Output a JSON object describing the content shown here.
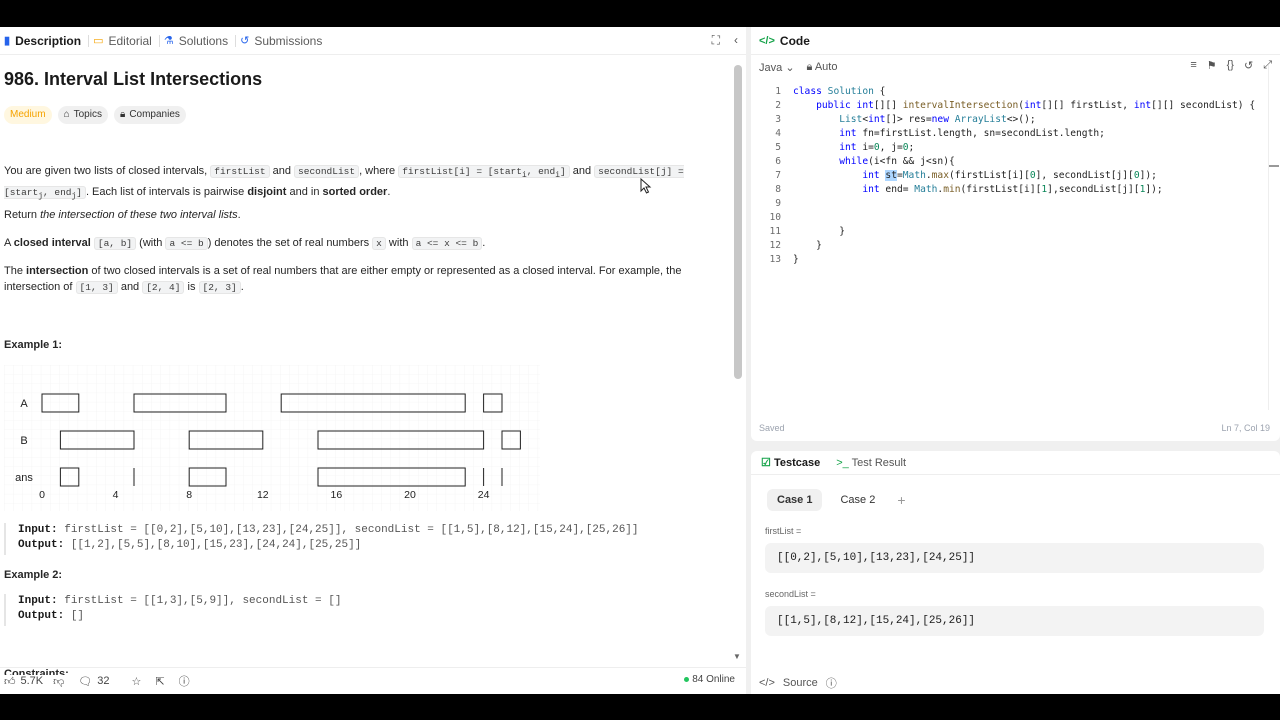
{
  "left_tabs": [
    {
      "label": "Description",
      "icon": "description-icon"
    },
    {
      "label": "Editorial",
      "icon": "editorial-icon"
    },
    {
      "label": "Solutions",
      "icon": "solutions-icon"
    },
    {
      "label": "Submissions",
      "icon": "history-icon"
    }
  ],
  "problem": {
    "title": "986. Interval List Intersections",
    "difficulty": "Medium",
    "topics_label": "Topics",
    "companies_label": "Companies",
    "p1_a": "You are given two lists of closed intervals, ",
    "p1_code1": "firstList",
    "p1_b": " and ",
    "p1_code2": "secondList",
    "p1_c": ", where ",
    "p1_code3": "firstList[i] = [start",
    "p1_sub3a": "i",
    "p1_code3b": ", end",
    "p1_sub3b": "i",
    "p1_code3c": "]",
    "p1_d": " and ",
    "p1_code4": "secondList[j] = [start",
    "p1_sub4a": "j",
    "p1_code4b": ", end",
    "p1_sub4b": "j",
    "p1_code4c": "]",
    "p1_e": ". Each list of intervals is pairwise ",
    "p1_bold1": "disjoint",
    "p1_f": " and in ",
    "p1_bold2": "sorted order",
    "p1_g": ".",
    "p2_a": "Return ",
    "p2_em": "the intersection of these two interval lists",
    "p2_b": ".",
    "p3_a": "A ",
    "p3_bold": "closed interval",
    "p3_code1": "[a, b]",
    "p3_b": " (with ",
    "p3_code2": "a <= b",
    "p3_c": ") denotes the set of real numbers ",
    "p3_code3": "x",
    "p3_d": " with ",
    "p3_code4": "a <= x <= b",
    "p3_e": ".",
    "p4_a": "The ",
    "p4_bold": "intersection",
    "p4_b": " of two closed intervals is a set of real numbers that are either empty or represented as a closed interval. For example, the intersection of ",
    "p4_code1": "[1, 3]",
    "p4_c": " and ",
    "p4_code2": "[2, 4]",
    "p4_d": " is ",
    "p4_code3": "[2, 3]",
    "p4_e": ".",
    "example1_title": "Example 1:",
    "example1_input_label": "Input:",
    "example1_input": "firstList = [[0,2],[5,10],[13,23],[24,25]], secondList = [[1,5],[8,12],[15,24],[25,26]]",
    "example1_output_label": "Output:",
    "example1_output": "[[1,2],[5,5],[8,10],[15,23],[24,24],[25,25]]",
    "example2_title": "Example 2:",
    "example2_input_label": "Input:",
    "example2_input": "firstList = [[1,3],[5,9]], secondList = []",
    "example2_output_label": "Output:",
    "example2_output": "[]",
    "constraints_title": "Constraints:"
  },
  "figure": {
    "row_labels": [
      "A",
      "B",
      "ans"
    ],
    "x_ticks": [
      "0",
      "4",
      "8",
      "12",
      "16",
      "20",
      "24"
    ],
    "A": [
      [
        0,
        2
      ],
      [
        5,
        10
      ],
      [
        13,
        23
      ],
      [
        24,
        25
      ]
    ],
    "B": [
      [
        1,
        5
      ],
      [
        8,
        12
      ],
      [
        15,
        24
      ],
      [
        25,
        26
      ]
    ],
    "ans_bars": [
      [
        1,
        2
      ],
      [
        8,
        10
      ],
      [
        15,
        23
      ]
    ],
    "ans_points": [
      5,
      24,
      25
    ]
  },
  "bottom_bar": {
    "likes": "5.7K",
    "comments": "32",
    "online": "84 Online"
  },
  "code_panel": {
    "title": "Code",
    "language": "Java",
    "mode": "Auto",
    "status": "Saved",
    "cursor_pos": "Ln 7, Col 19"
  },
  "code_lines": [
    "1",
    "2",
    "3",
    "4",
    "5",
    "6",
    "7",
    "8",
    "9",
    "10",
    "11",
    "12",
    "13"
  ],
  "test_panel": {
    "tab_testcase": "Testcase",
    "tab_result": "Test Result",
    "case1": "Case 1",
    "case2": "Case 2",
    "var1_label": "firstList =",
    "var1_value": "[[0,2],[5,10],[13,23],[24,25]]",
    "var2_label": "secondList =",
    "var2_value": "[[1,5],[8,12],[15,24],[25,26]]",
    "source_label": "Source"
  }
}
